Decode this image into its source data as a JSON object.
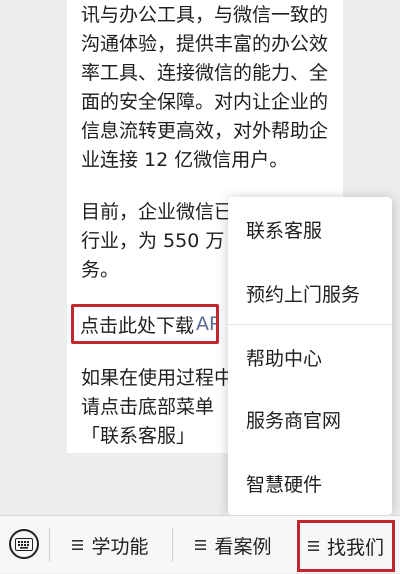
{
  "message": {
    "para1": "讯与办公工具，与微信一致的\n沟通体验，提供丰富的办公效\n率工具、连接微信的能力、全\n面的安全保障。对内让企业的\n信息流转更高效，对外帮助企\n业连接 12 亿微信用户。",
    "para2": "目前，企业微信已\n行业，为 550 万 +\n务。",
    "download_link": {
      "text": "点击此处下载",
      "accent": "AP"
    },
    "para4": "如果在使用过程中\n请点击底部菜单\n「联系客服」"
  },
  "popup_menu": {
    "items": [
      "联系客服",
      "预约上门服务",
      "帮助中心",
      "服务商官网",
      "智慧硬件"
    ]
  },
  "bottom_menu": {
    "items": [
      "学功能",
      "看案例",
      "找我们"
    ]
  },
  "colors": {
    "highlight_border": "#c0262d",
    "link": "#576b95",
    "background": "#ededed"
  }
}
